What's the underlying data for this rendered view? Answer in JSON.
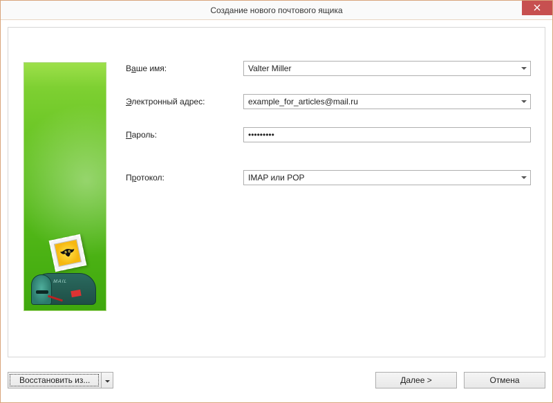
{
  "window": {
    "title": "Создание нового почтового ящика"
  },
  "sidebar": {
    "mailbox_label": "MAIL"
  },
  "form": {
    "name": {
      "label_pre": "В",
      "label_underline": "а",
      "label_post": "ше имя:",
      "value": "Valter Miller"
    },
    "email": {
      "label_underline": "Э",
      "label_post": "лектронный адрес:",
      "value": "example_for_articles@mail.ru"
    },
    "password": {
      "label_underline": "П",
      "label_post": "ароль:",
      "value": "•••••••••"
    },
    "protocol": {
      "label_pre": "П",
      "label_underline": "р",
      "label_post": "отокол:",
      "value": "IMAP или POP"
    }
  },
  "buttons": {
    "restore": "Восстановить из...",
    "next": "Далее  >",
    "cancel": "Отмена"
  }
}
